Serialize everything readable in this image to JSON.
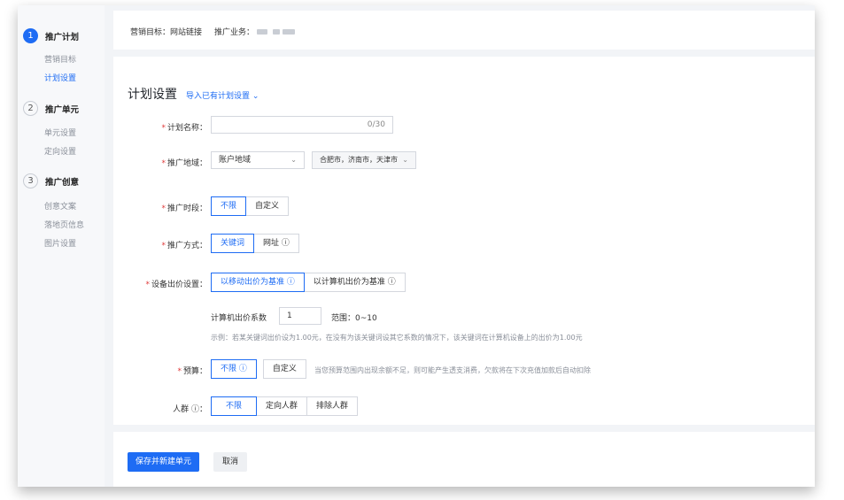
{
  "sidebar": {
    "steps": [
      {
        "num": "1",
        "title": "推广计划",
        "subs": [
          "营销目标",
          "计划设置"
        ]
      },
      {
        "num": "2",
        "title": "推广单元",
        "subs": [
          "单元设置",
          "定向设置"
        ]
      },
      {
        "num": "3",
        "title": "推广创意",
        "subs": [
          "创意文案",
          "落地页信息",
          "图片设置"
        ]
      }
    ]
  },
  "top": {
    "goal_label": "营销目标：",
    "goal_value": "网站链接",
    "biz_label": "推广业务："
  },
  "main": {
    "title": "计划设置",
    "import_link": "导入已有计划设置",
    "plan_name": {
      "label": "计划名称：",
      "value": "",
      "counter": "0/30"
    },
    "region": {
      "label": "推广地域：",
      "select": "账户地域",
      "cities": "合肥市，济南市，天津市"
    },
    "period": {
      "label": "推广时段：",
      "options": [
        "不限",
        "自定义"
      ]
    },
    "method": {
      "label": "推广方式：",
      "options": [
        "关键词",
        "网址 ⓘ"
      ]
    },
    "device": {
      "label": "设备出价设置：",
      "options": [
        "以移动出价为基准 ⓘ",
        "以计算机出价为基准 ⓘ"
      ]
    },
    "pc_coef": {
      "label": "计算机出价系数",
      "value": "1",
      "range": "范围：0~10"
    },
    "example": "示例：若某关键词出价设为1.00元，在没有为该关键词设其它系数的情况下，该关键词在计算机设备上的出价为1.00元",
    "budget": {
      "label": "预算：",
      "options": [
        "不限 ⓘ",
        "自定义"
      ],
      "note": "当您预算范围内出现余额不足，则可能产生透支消费，欠款将在下次充值加款后自动扣除"
    },
    "crowd": {
      "label": "人群 ⓘ：",
      "options": [
        "不限",
        "定向人群",
        "排除人群"
      ]
    }
  },
  "footer": {
    "save_label": "保存并新建单元",
    "cancel_label": "取消"
  },
  "colors": {
    "accent": "#1e6cf4",
    "required": "#e03a3a"
  }
}
